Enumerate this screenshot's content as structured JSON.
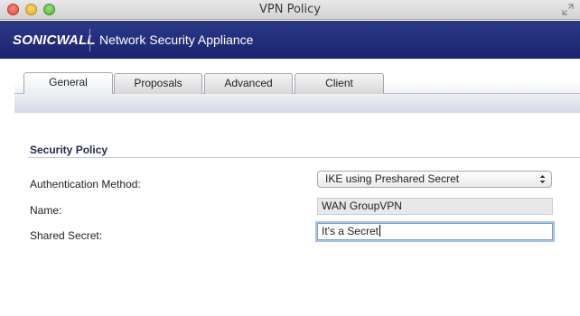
{
  "window": {
    "title": "VPN Policy",
    "controls": [
      "close",
      "minimize",
      "zoom"
    ]
  },
  "banner": {
    "logo": "SONICWALL",
    "product_name": "Network Security Appliance",
    "background_color": "#1a2470"
  },
  "tabs": [
    {
      "label": "General",
      "active": true
    },
    {
      "label": "Proposals",
      "active": false
    },
    {
      "label": "Advanced",
      "active": false
    },
    {
      "label": "Client",
      "active": false
    }
  ],
  "security_policy": {
    "section_title": "Security Policy",
    "auth_method": {
      "label": "Authentication Method:",
      "selected": "IKE using Preshared Secret"
    },
    "name": {
      "label": "Name:",
      "value": "WAN GroupVPN"
    },
    "shared_secret": {
      "label": "Shared Secret:",
      "value": "It's a Secret"
    }
  }
}
